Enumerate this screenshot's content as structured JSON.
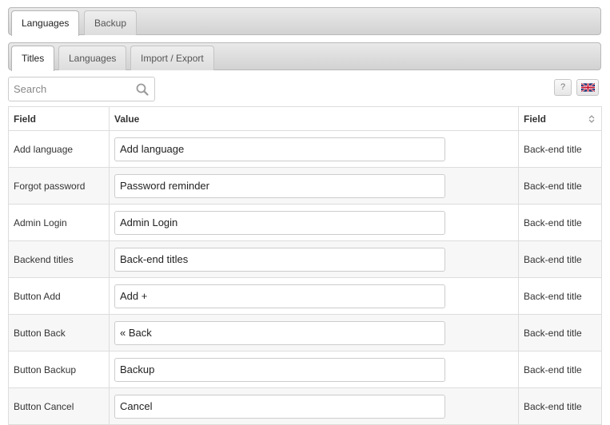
{
  "top_tabs": [
    {
      "label": "Languages",
      "active": true
    },
    {
      "label": "Backup",
      "active": false
    }
  ],
  "sub_tabs": [
    {
      "label": "Titles",
      "active": true
    },
    {
      "label": "Languages",
      "active": false
    },
    {
      "label": "Import / Export",
      "active": false
    }
  ],
  "search": {
    "placeholder": "Search",
    "value": ""
  },
  "help": {
    "label": "?"
  },
  "language": {
    "icon": "uk-flag-icon"
  },
  "table": {
    "headers": [
      "Field",
      "Value",
      "Field"
    ],
    "rows": [
      {
        "field": "Add language",
        "value": "Add language",
        "type": "Back-end title"
      },
      {
        "field": "Forgot password",
        "value": "Password reminder",
        "type": "Back-end title"
      },
      {
        "field": "Admin Login",
        "value": "Admin Login",
        "type": "Back-end title"
      },
      {
        "field": "Backend titles",
        "value": "Back-end titles",
        "type": "Back-end title"
      },
      {
        "field": "Button Add",
        "value": "Add +",
        "type": "Back-end title"
      },
      {
        "field": "Button Back",
        "value": "« Back",
        "type": "Back-end title"
      },
      {
        "field": "Button Backup",
        "value": "Backup",
        "type": "Back-end title"
      },
      {
        "field": "Button Cancel",
        "value": "Cancel",
        "type": "Back-end title"
      }
    ]
  },
  "colors": {
    "border": "#dddddd",
    "tabbar": "#d2d2d2",
    "stripe": "#f7f7f7"
  }
}
